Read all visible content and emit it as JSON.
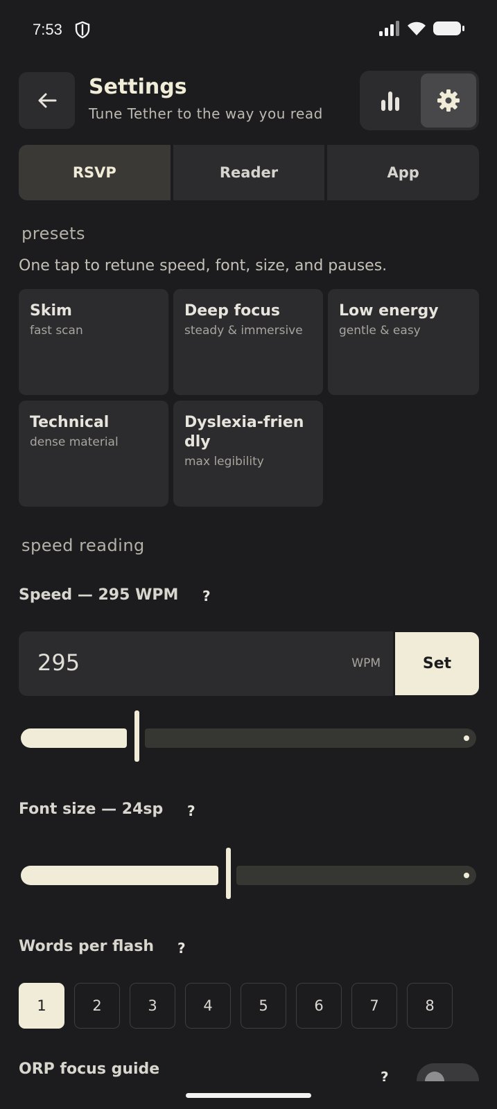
{
  "status_bar": {
    "time": "7:53"
  },
  "header": {
    "title": "Settings",
    "subtitle": "Tune Tether to the way you read"
  },
  "tabs": [
    {
      "label": "RSVP",
      "selected": true
    },
    {
      "label": "Reader",
      "selected": false
    },
    {
      "label": "App",
      "selected": false
    }
  ],
  "presets": {
    "section_label": "presets",
    "description": "One tap to retune speed, font, size, and pauses.",
    "items": [
      {
        "name": "Skim",
        "sub": "fast scan"
      },
      {
        "name": "Deep focus",
        "sub": "steady & immersive"
      },
      {
        "name": "Low energy",
        "sub": "gentle & easy"
      },
      {
        "name": "Technical",
        "sub": "dense material"
      },
      {
        "name": "Dyslexia-friendly",
        "sub": "max legibility"
      }
    ]
  },
  "speed_reading": {
    "section_label": "speed reading",
    "speed": {
      "label": "Speed — 295 WPM",
      "help": "?",
      "value": "295",
      "unit": "WPM",
      "set_label": "Set",
      "slider_fraction": 0.21
    },
    "font_size": {
      "label": "Font size — 24sp",
      "help": "?",
      "slider_fraction": 0.43
    },
    "words_per_flash": {
      "label": "Words per flash",
      "help": "?",
      "options": [
        "1",
        "2",
        "3",
        "4",
        "5",
        "6",
        "7",
        "8"
      ],
      "selected": "1"
    },
    "orp": {
      "label": "ORP focus guide",
      "help": "?",
      "enabled": false
    }
  },
  "colors": {
    "background": "#1c1c1e",
    "surface": "#2c2c2e",
    "accent": "#f1ecd8"
  }
}
